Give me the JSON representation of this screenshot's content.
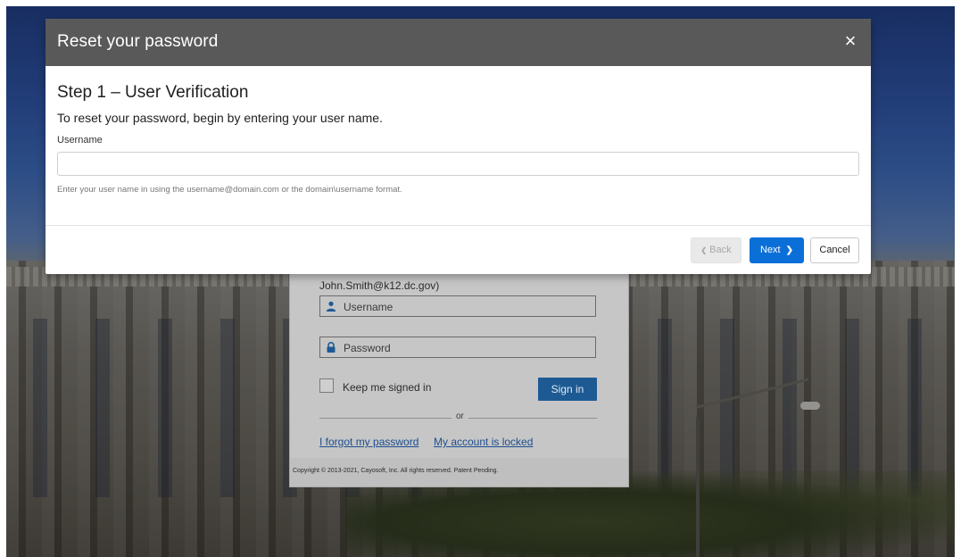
{
  "modal": {
    "title": "Reset your password",
    "close_label": "×",
    "step_title": "Step 1 – User Verification",
    "step_description": "To reset your password, begin by entering your user name.",
    "field_label": "Username",
    "field_value": "",
    "field_placeholder": "",
    "field_help": "Enter your user name in using the username@domain.com or the domain\\username format.",
    "back_label": "Back",
    "back_chevron": "❮",
    "next_label": "Next",
    "next_chevron": "❯",
    "cancel_label": "Cancel"
  },
  "login": {
    "hint_text": "John.Smith@k12.dc.gov)",
    "username_placeholder": "Username",
    "password_placeholder": "Password",
    "keep_signed_in_label": "Keep me signed in",
    "signin_label": "Sign in",
    "or_text": "or",
    "forgot_password_link": "I forgot my password",
    "account_locked_link": "My account is locked",
    "copyright": "Copyright © 2013-2021, Cayosoft, Inc. All rights reserved. Patent Pending."
  },
  "colors": {
    "modal_header_bg": "#595959",
    "primary_button": "#0b6fd8",
    "signin_button": "#1d5a94",
    "link_color": "#1f4f8f"
  },
  "icons": {
    "close": "close-icon",
    "back": "chevron-left-icon",
    "next": "chevron-right-icon",
    "user": "user-icon",
    "lock": "lock-icon"
  }
}
